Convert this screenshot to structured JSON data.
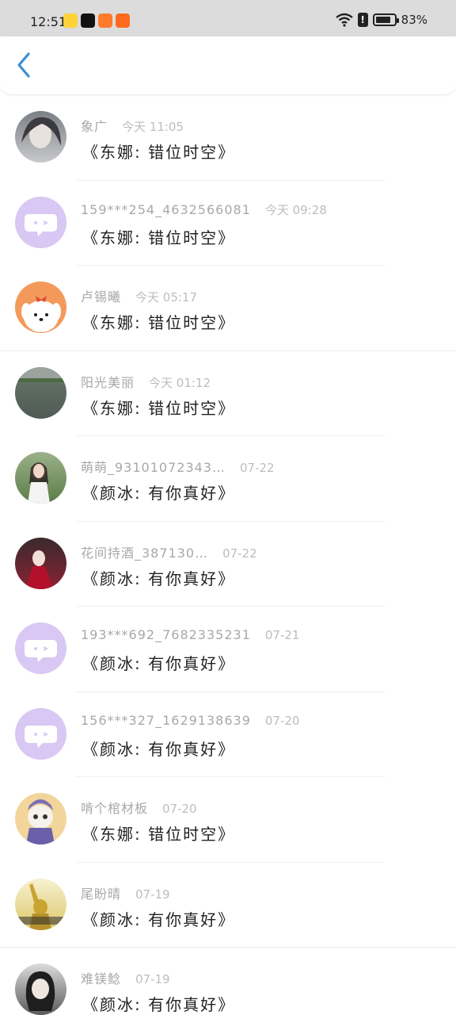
{
  "status_bar": {
    "time": "12:51",
    "battery": "83%",
    "app_icons": [
      "qq-browser-icon",
      "tiktok-icon",
      "taobao-icon",
      "taobao-icon"
    ]
  },
  "header": {
    "back_icon": "chevron-left-icon",
    "accent": "#3a8fd8"
  },
  "rows": [
    {
      "name": "象广",
      "time": "今天 11:05",
      "message": "《东娜: 错位时空》",
      "avatar": "anime-portrait"
    },
    {
      "name": "159***254_4632566081",
      "time": "今天 09:28",
      "message": "《东娜: 错位时空》",
      "avatar": "chat-bubble"
    },
    {
      "name": "卢锡曦",
      "time": "今天 05:17",
      "message": "《东娜: 错位时空》",
      "avatar": "cartoon-dog"
    },
    {
      "name": "阳光美丽",
      "time": "今天 01:12",
      "message": "《东娜: 错位时空》",
      "avatar": "lake-photo"
    },
    {
      "name": "萌萌_93101072343…",
      "time": "07-22",
      "message": "《颜冰: 有你真好》",
      "avatar": "girl-photo"
    },
    {
      "name": "花间持酒_387130…",
      "time": "07-22",
      "message": "《颜冰: 有你真好》",
      "avatar": "red-dress-photo"
    },
    {
      "name": "193***692_7682335231",
      "time": "07-21",
      "message": "《颜冰: 有你真好》",
      "avatar": "chat-bubble"
    },
    {
      "name": "156***327_1629138639",
      "time": "07-20",
      "message": "《颜冰: 有你真好》",
      "avatar": "chat-bubble"
    },
    {
      "name": "啃个棺材板",
      "time": "07-20",
      "message": "《东娜: 错位时空》",
      "avatar": "comic-character"
    },
    {
      "name": "尾盼晴",
      "time": "07-19",
      "message": "《颜冰: 有你真好》",
      "avatar": "yellow-figure"
    },
    {
      "name": "难镁鲶",
      "time": "07-19",
      "message": "《颜冰: 有你真好》",
      "avatar": "dark-hair-photo"
    }
  ]
}
